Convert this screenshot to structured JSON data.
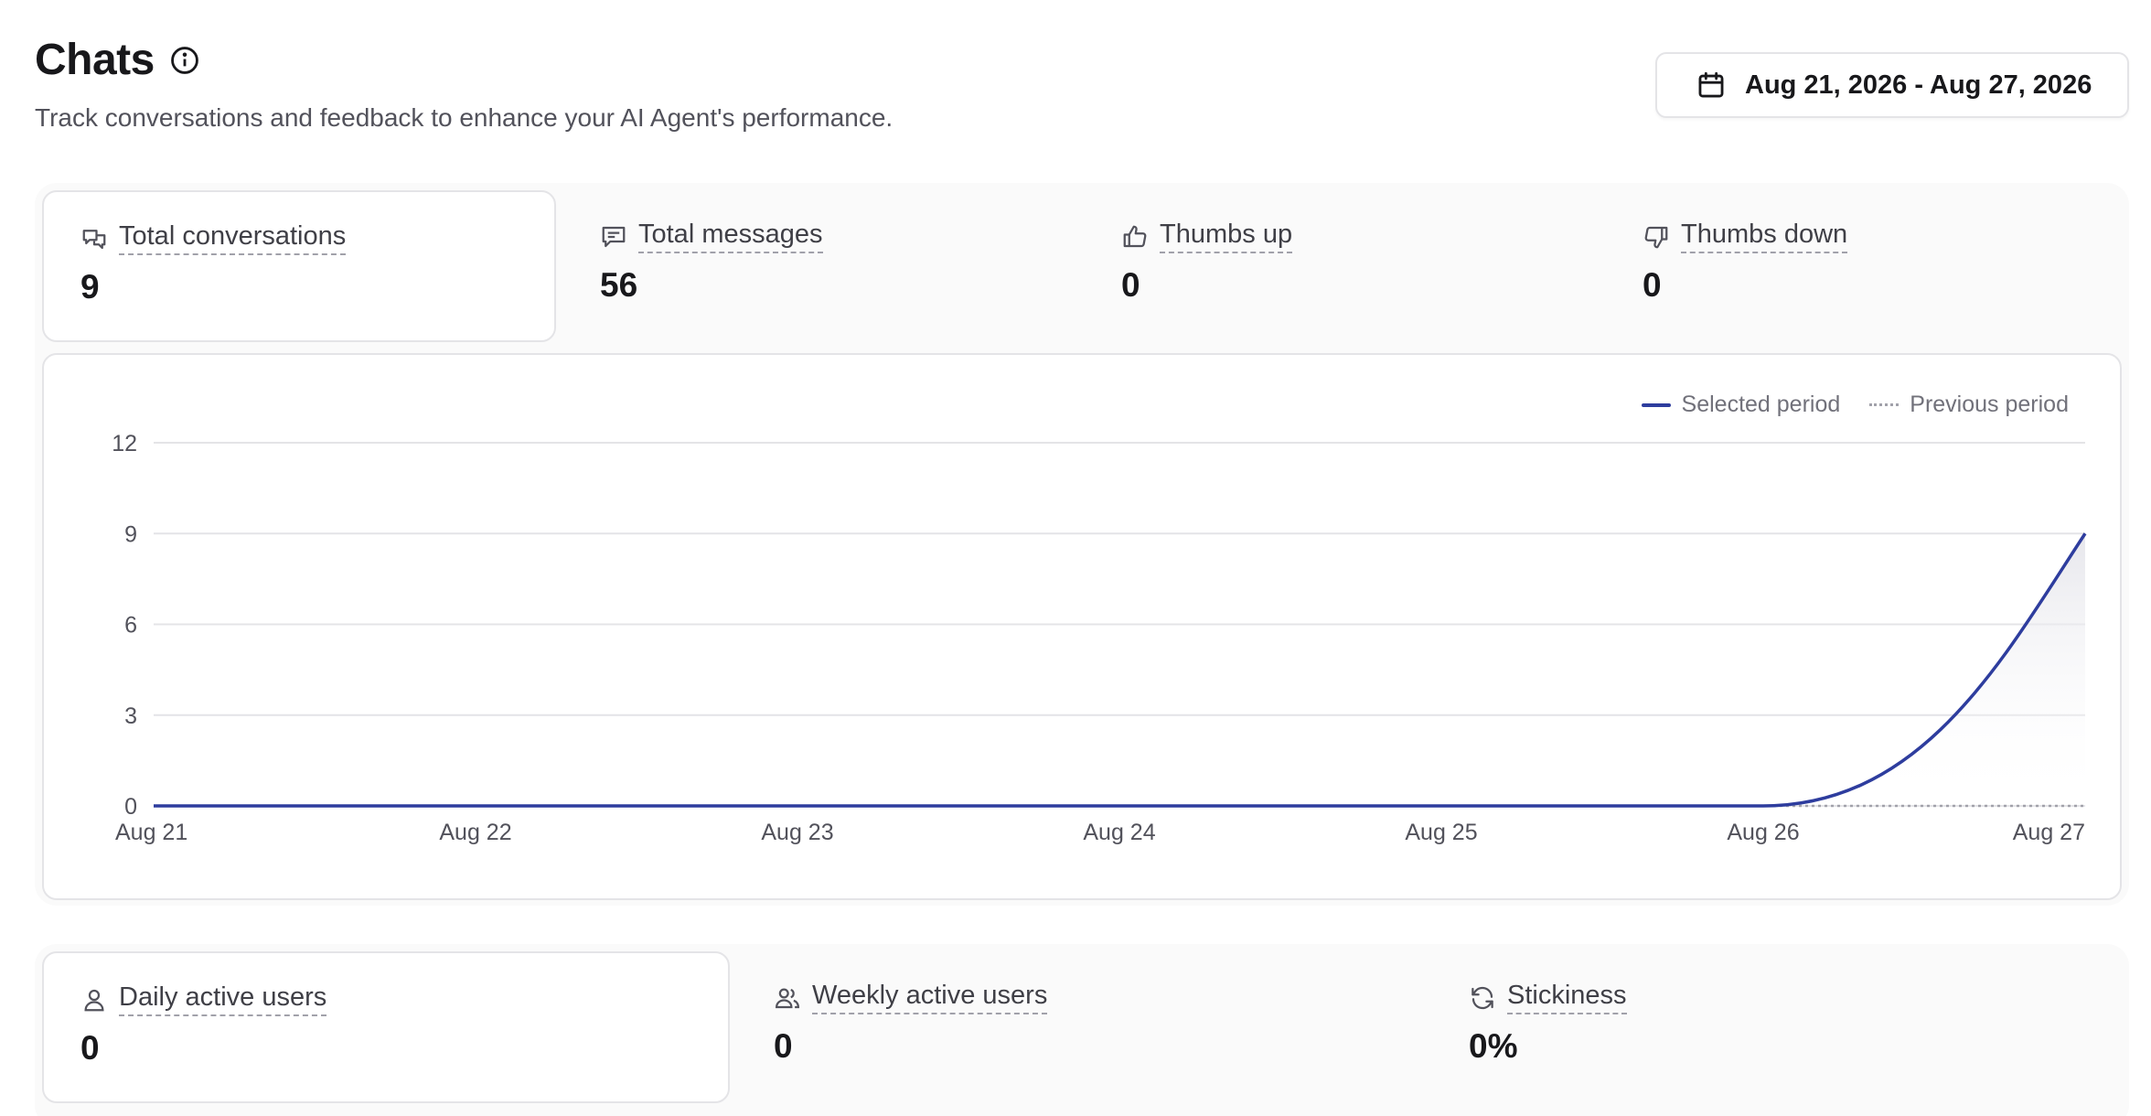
{
  "header": {
    "title": "Chats",
    "title_icon": "info-icon",
    "subtitle": "Track conversations and feedback to enhance your AI Agent's performance."
  },
  "date_range": {
    "label": "Aug 21, 2026 - Aug 27, 2026",
    "icon": "calendar-icon"
  },
  "metrics": [
    {
      "label": "Total conversations",
      "value": "9",
      "icon": "chat-bubbles-icon",
      "active": true
    },
    {
      "label": "Total messages",
      "value": "56",
      "icon": "message-icon",
      "active": false
    },
    {
      "label": "Thumbs up",
      "value": "0",
      "icon": "thumbs-up-icon",
      "active": false
    },
    {
      "label": "Thumbs down",
      "value": "0",
      "icon": "thumbs-down-icon",
      "active": false
    }
  ],
  "user_metrics": [
    {
      "label": "Daily active users",
      "value": "0",
      "icon": "user-icon",
      "active": true
    },
    {
      "label": "Weekly active users",
      "value": "0",
      "icon": "users-icon",
      "active": false
    },
    {
      "label": "Stickiness",
      "value": "0%",
      "icon": "refresh-icon",
      "active": false
    }
  ],
  "chart_data": {
    "type": "line",
    "x": [
      "Aug 21",
      "Aug 22",
      "Aug 23",
      "Aug 24",
      "Aug 25",
      "Aug 26",
      "Aug 27"
    ],
    "series": [
      {
        "name": "Selected period",
        "values": [
          0,
          0,
          0,
          0,
          0,
          0,
          9
        ],
        "color": "#2e3d9e",
        "style": "solid"
      },
      {
        "name": "Previous period",
        "values": [
          0,
          0,
          0,
          0,
          0,
          0,
          0
        ],
        "color": "#a1a1aa",
        "style": "dotted"
      }
    ],
    "yticks": [
      0,
      3,
      6,
      9,
      12
    ],
    "ylim": [
      0,
      12
    ],
    "grid": true,
    "legend": "top-right"
  },
  "colors": {
    "accent": "#2e3d9e",
    "border": "#e4e4e7",
    "panel": "#fafafa"
  }
}
